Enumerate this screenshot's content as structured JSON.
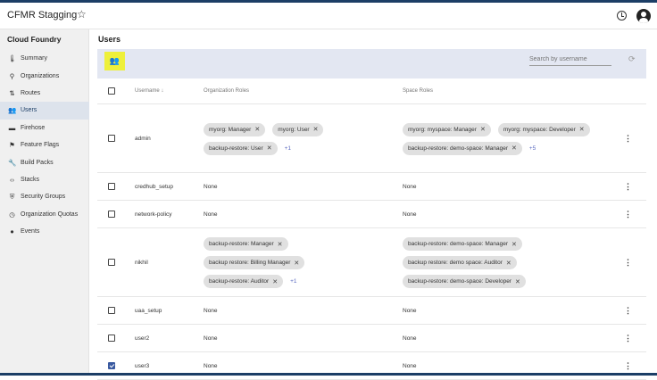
{
  "appbar": {
    "title": "CFMR Stagging"
  },
  "sidebar": {
    "title": "Cloud Foundry",
    "items": [
      {
        "label": "Summary",
        "icon": "summary-icon"
      },
      {
        "label": "Organizations",
        "icon": "organizations-icon"
      },
      {
        "label": "Routes",
        "icon": "routes-icon"
      },
      {
        "label": "Users",
        "icon": "users-icon"
      },
      {
        "label": "Firehose",
        "icon": "firehose-icon"
      },
      {
        "label": "Feature Flags",
        "icon": "flag-icon"
      },
      {
        "label": "Build Packs",
        "icon": "build-icon"
      },
      {
        "label": "Stacks",
        "icon": "code-icon"
      },
      {
        "label": "Security Groups",
        "icon": "security-icon"
      },
      {
        "label": "Organization Quotas",
        "icon": "quota-icon"
      },
      {
        "label": "Events",
        "icon": "events-icon"
      }
    ]
  },
  "main": {
    "title": "Users",
    "search_placeholder": "Search by username",
    "columns": {
      "username": "Username",
      "org_roles": "Organization Roles",
      "space_roles": "Space Roles"
    },
    "none_label": "None",
    "rows": [
      {
        "username": "admin",
        "checked": false,
        "org_roles": [
          "myorg: Manager",
          "myorg: User",
          "backup-restore: User"
        ],
        "org_more": "+1",
        "space_roles": [
          "myorg: myspace: Manager",
          "myorg: myspace: Developer",
          "backup-restore: demo-space: Manager"
        ],
        "space_more": "+5"
      },
      {
        "username": "credhub_setup",
        "checked": false
      },
      {
        "username": "network-policy",
        "checked": false
      },
      {
        "username": "nikhil",
        "checked": false,
        "org_roles": [
          "backup-restore: Manager",
          "backup restore: Billing Manager",
          "backup-restore: Auditor"
        ],
        "org_more": "+1",
        "space_roles": [
          "backup-restore: demo-space: Manager",
          "backup restore: demo space: Auditor",
          "backup-restore: demo-space: Developer"
        ]
      },
      {
        "username": "uaa_setup",
        "checked": false
      },
      {
        "username": "user2",
        "checked": false
      },
      {
        "username": "user3",
        "checked": true
      }
    ]
  }
}
